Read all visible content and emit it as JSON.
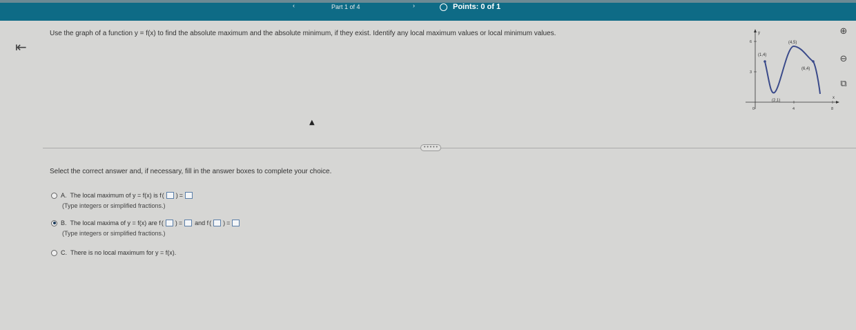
{
  "header": {
    "nav_left": "‹",
    "part": "Part 1 of 4",
    "nav_right": "›",
    "points": "Points: 0 of 1"
  },
  "back_icon": "back-arrow-icon",
  "question": "Use the graph of a function y = f(x) to find the absolute maximum and the absolute minimum, if they exist. Identify any local maximum values or local minimum values.",
  "graph": {
    "y_axis_label": "y",
    "x_axis_label": "x",
    "y_tick_6": "6",
    "y_tick_3": "3",
    "x_tick_0": "0",
    "x_tick_4": "4",
    "x_tick_8": "8",
    "points": [
      {
        "label": "(1,4)",
        "x": 1,
        "y": 4
      },
      {
        "label": "(2,1)",
        "x": 2,
        "y": 1
      },
      {
        "label": "(4,5)",
        "x": 4,
        "y": 5
      },
      {
        "label": "(6,4)",
        "x": 6,
        "y": 4
      }
    ]
  },
  "tools": [
    "zoom-in-icon",
    "zoom-out-icon",
    "popout-icon"
  ],
  "more_button": "• • • • •",
  "instruction": "Select the correct answer and, if necessary, fill in the answer boxes to complete your choice.",
  "options": {
    "a": {
      "letter": "A.",
      "text_before": "The local maximum of y = f(x) is f",
      "hint": "(Type integers or simplified fractions.)"
    },
    "b": {
      "letter": "B.",
      "text_before": "The local maxima of y = f(x) are f",
      "text_and": "and f",
      "hint": "(Type integers or simplified fractions.)"
    },
    "c": {
      "letter": "C.",
      "text": "There is no local maximum for y = f(x)."
    },
    "selected": "b"
  }
}
